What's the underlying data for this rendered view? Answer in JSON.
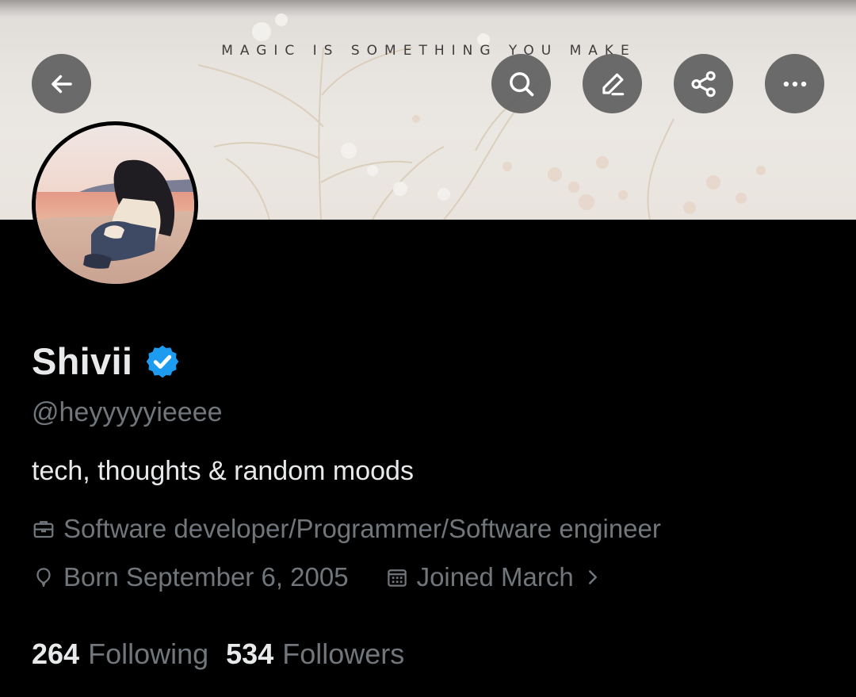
{
  "banner": {
    "quote": "MAGIC IS SOMETHING YOU MAKE"
  },
  "toolbar": {
    "back_icon": "arrow-left-icon",
    "search_icon": "search-icon",
    "edit_icon": "pencil-icon",
    "share_icon": "share-icon",
    "more_icon": "more-horizontal-icon"
  },
  "profile": {
    "display_name": "Shivii",
    "verified_icon": "verified-badge-icon",
    "handle": "@heyyyyyieeee",
    "bio": "tech, thoughts & random moods",
    "profession": "Software developer/Programmer/Software engineer",
    "birthday": "Born September 6, 2005",
    "joined": "Joined March"
  },
  "stats": {
    "following_count": "264",
    "following_label": "Following",
    "followers_count": "534",
    "followers_label": "Followers"
  },
  "colors": {
    "background": "#000000",
    "primary_text": "#e7e9ea",
    "secondary_text": "#71767b",
    "verified_blue": "#1d9bf0",
    "button_bg": "#5f5f5f"
  }
}
